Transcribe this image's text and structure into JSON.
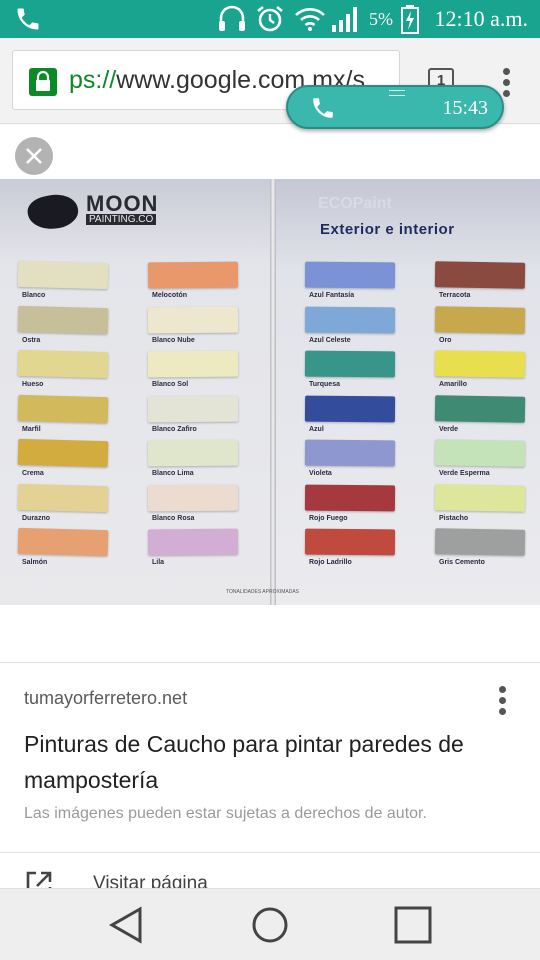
{
  "status_bar": {
    "battery_percent": "5%",
    "time": "12:10 a.m.",
    "icons": [
      "phone-icon",
      "headset-icon",
      "alarm-icon",
      "wifi-icon",
      "signal-icon",
      "battery-charging-icon"
    ]
  },
  "browser": {
    "url_scheme": "ps://",
    "url_rest": "www.google.com.mx/s",
    "tab_count": "1"
  },
  "call_bubble": {
    "duration": "15:43"
  },
  "catalog_image": {
    "brand": "MOON",
    "brand_sub": "PAINTING.CO",
    "product": "ECOPaint",
    "subtitle": "Exterior e interior",
    "note": "TONALIDADES APROXIMADAS",
    "swatches": [
      {
        "label": "Blanco",
        "color": "#e3e0c2"
      },
      {
        "label": "Ostra",
        "color": "#c7bf9a"
      },
      {
        "label": "Hueso",
        "color": "#e1d790"
      },
      {
        "label": "Marfil",
        "color": "#d2b95c"
      },
      {
        "label": "Crema",
        "color": "#d2ac3f"
      },
      {
        "label": "Durazno",
        "color": "#e4d295"
      },
      {
        "label": "Salmón",
        "color": "#e7a072"
      },
      {
        "label": "Melocotón",
        "color": "#e8986a"
      },
      {
        "label": "Blanco Nube",
        "color": "#ece7cd"
      },
      {
        "label": "Blanco Sol",
        "color": "#ede9c1"
      },
      {
        "label": "Blanco Zafiro",
        "color": "#e4e4d6"
      },
      {
        "label": "Blanco Lima",
        "color": "#e0e6cc"
      },
      {
        "label": "Blanco Rosa",
        "color": "#ecdcd0"
      },
      {
        "label": "Lila",
        "color": "#d2aed4"
      },
      {
        "label": "Azul Fantasía",
        "color": "#7c92d6"
      },
      {
        "label": "Azul Celeste",
        "color": "#7ea8d8"
      },
      {
        "label": "Turquesa",
        "color": "#38958a"
      },
      {
        "label": "Azul",
        "color": "#334d9c"
      },
      {
        "label": "Violeta",
        "color": "#8e97cf"
      },
      {
        "label": "Rojo Fuego",
        "color": "#a6393d"
      },
      {
        "label": "Rojo Ladrillo",
        "color": "#c04a3d"
      },
      {
        "label": "Terracota",
        "color": "#8b4a3f"
      },
      {
        "label": "Oro",
        "color": "#c8a84d"
      },
      {
        "label": "Amarillo",
        "color": "#e8df4e"
      },
      {
        "label": "Verde",
        "color": "#3f8a72"
      },
      {
        "label": "Verde Esperma",
        "color": "#c5e3b8"
      },
      {
        "label": "Pistacho",
        "color": "#dde69a"
      },
      {
        "label": "Gris Cemento",
        "color": "#9e9f9f"
      }
    ]
  },
  "result": {
    "source": "tumayorferretero.net",
    "title": "Pinturas de Caucho para pintar paredes de mampostería",
    "copyright": "Las imágenes pueden estar sujetas a derechos de autor.",
    "visit_label": "Visitar página"
  },
  "nav_bar": {
    "icons": [
      "back-icon",
      "home-icon",
      "recents-icon"
    ]
  },
  "colors": {
    "status_bar": "#19a48f",
    "call_bubble": "#3bb8ad",
    "secure_green": "#0b8a26"
  }
}
